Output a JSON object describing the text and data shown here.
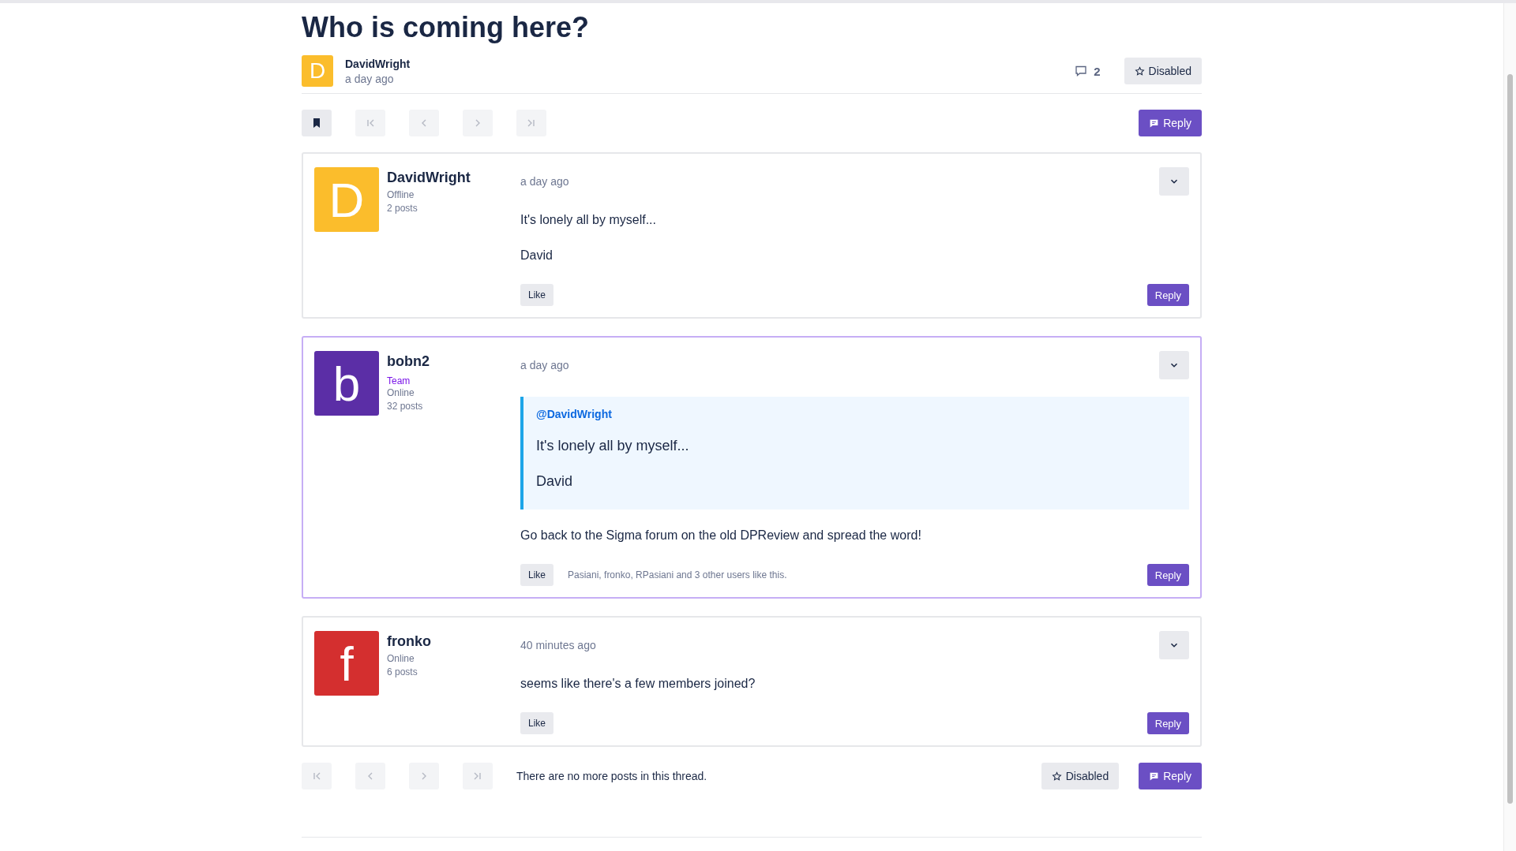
{
  "topic": {
    "title": "Who is coming here?",
    "author": {
      "initial": "D",
      "name": "DavidWright",
      "color": "#fbbd2c"
    },
    "time": "a day ago",
    "reply_count": "2",
    "favorite_label": "Disabled"
  },
  "toolbar": {
    "bookmark": {
      "selected": true
    },
    "nav": [
      {
        "kind": "first",
        "disabled": true
      },
      {
        "kind": "prev",
        "disabled": true
      },
      {
        "kind": "next",
        "disabled": true
      },
      {
        "kind": "last",
        "disabled": true
      }
    ],
    "reply_label": "Reply"
  },
  "posts": [
    {
      "initial": "D",
      "color": "#fbbd2c",
      "name": "DavidWright",
      "status": "Offline",
      "post_count": "2 posts",
      "time": "a day ago",
      "highlighted": false,
      "paragraphs": [
        "It's lonely all by myself...",
        "David"
      ],
      "like_label": "Like",
      "reply_label": "Reply"
    },
    {
      "initial": "b",
      "color": "#5b2ea6",
      "name": "bobn2",
      "role": "Team",
      "status": "Online",
      "post_count": "32 posts",
      "time": "a day ago",
      "highlighted": true,
      "quote": {
        "mention": "@DavidWright",
        "paragraphs": [
          "It's lonely all by myself...",
          "David"
        ]
      },
      "paragraphs": [
        "Go back to the Sigma forum on the old DPReview and spread the word!"
      ],
      "like_label": "Like",
      "likes_text": "Pasiani, fronko, RPasiani and 3 other users like this.",
      "reply_label": "Reply"
    },
    {
      "initial": "f",
      "color": "#d42f2f",
      "name": "fronko",
      "status": "Online",
      "post_count": "6 posts",
      "time": "40 minutes ago",
      "highlighted": false,
      "paragraphs": [
        "seems like there's a few members joined?"
      ],
      "like_label": "Like",
      "reply_label": "Reply"
    }
  ],
  "footer": {
    "nav": [
      {
        "kind": "first",
        "disabled": true
      },
      {
        "kind": "prev",
        "disabled": true
      },
      {
        "kind": "next",
        "disabled": true
      },
      {
        "kind": "last",
        "disabled": true
      }
    ],
    "message": "There are no more posts in this thread.",
    "favorite_label": "Disabled",
    "reply_label": "Reply"
  }
}
